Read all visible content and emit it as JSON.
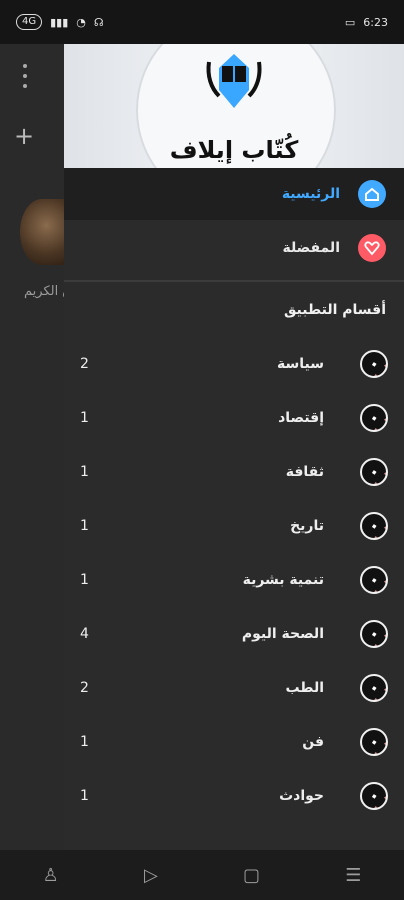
{
  "status_bar": {
    "left_badge": "4G",
    "right_text": "6:23"
  },
  "background": {
    "caption": "ق الكريم"
  },
  "drawer": {
    "logo_text": "كُتّاب إيلاف",
    "menu": [
      {
        "label": "الرئيسية",
        "icon": "home-icon",
        "color": "#41a9ff"
      },
      {
        "label": "المفضلة",
        "icon": "heart-icon",
        "color": "#ff5b66"
      }
    ],
    "section_title": "أقسام التطبيق",
    "categories": [
      {
        "label": "سياسة",
        "count": "2"
      },
      {
        "label": "إقتصاد",
        "count": "1"
      },
      {
        "label": "ثقافة",
        "count": "1"
      },
      {
        "label": "تاريخ",
        "count": "1"
      },
      {
        "label": "تنمية بشرية",
        "count": "1"
      },
      {
        "label": "الصحة اليوم",
        "count": "4"
      },
      {
        "label": "الطب",
        "count": "2"
      },
      {
        "label": "فن",
        "count": "1"
      },
      {
        "label": "حوادث",
        "count": "1"
      }
    ]
  },
  "nav_bar": {
    "items": [
      "accessibility-icon",
      "back-icon",
      "home-icon",
      "recents-icon"
    ]
  }
}
